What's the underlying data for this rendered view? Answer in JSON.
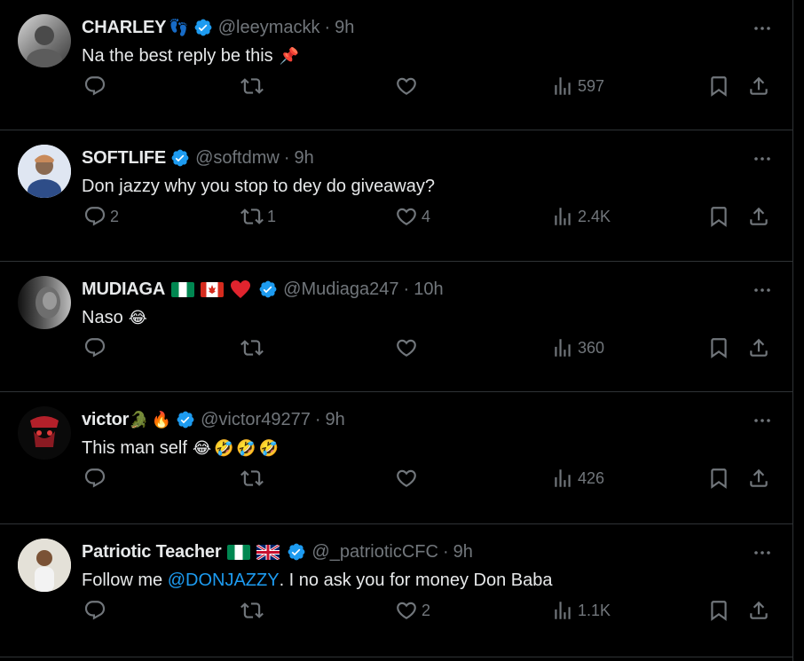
{
  "tweets": [
    {
      "name": "CHARLEY",
      "name_emojis": [
        "👣"
      ],
      "verified": true,
      "handle": "@leeymackk",
      "time": "9h",
      "text": "Na the best reply be this",
      "text_emojis": [
        "📌"
      ],
      "replies": "",
      "reposts": "",
      "likes": "",
      "views": "597"
    },
    {
      "name": "SOFTLIFE",
      "name_emojis": [],
      "verified": true,
      "handle": "@softdmw",
      "time": "9h",
      "text": "Don jazzy why you stop to dey do giveaway?",
      "text_emojis": [],
      "replies": "2",
      "reposts": "1",
      "likes": "4",
      "views": "2.4K"
    },
    {
      "name": "MUDIAGA",
      "name_emojis": [
        "flag-ng",
        "flag-ca",
        "❤"
      ],
      "verified": true,
      "handle": "@Mudiaga247",
      "time": "10h",
      "text": "Naso",
      "text_emojis": [
        "😂"
      ],
      "replies": "",
      "reposts": "",
      "likes": "",
      "views": "360"
    },
    {
      "name": "victor",
      "name_emojis": [
        "🐊",
        "🔥"
      ],
      "verified": true,
      "handle": "@victor49277",
      "time": "9h",
      "text": "This man self",
      "text_emojis": [
        "😂",
        "🤣",
        "🤣",
        "🤣"
      ],
      "replies": "",
      "reposts": "",
      "likes": "",
      "views": "426"
    },
    {
      "name": "Patriotic Teacher",
      "name_emojis": [
        "flag-ng",
        "flag-gb"
      ],
      "verified": true,
      "handle": "@_patrioticCFC",
      "time": "9h",
      "text_before": "Follow me ",
      "mention": "@DONJAZZY",
      "text_after": ". I no ask you for money Don Baba",
      "replies": "",
      "reposts": "",
      "likes": "2",
      "views": "1.1K"
    }
  ],
  "colors": {
    "background": "#000000",
    "text": "#e7e9ea",
    "muted": "#71767b",
    "accent": "#1d9bf0",
    "divider": "#2f3336"
  }
}
